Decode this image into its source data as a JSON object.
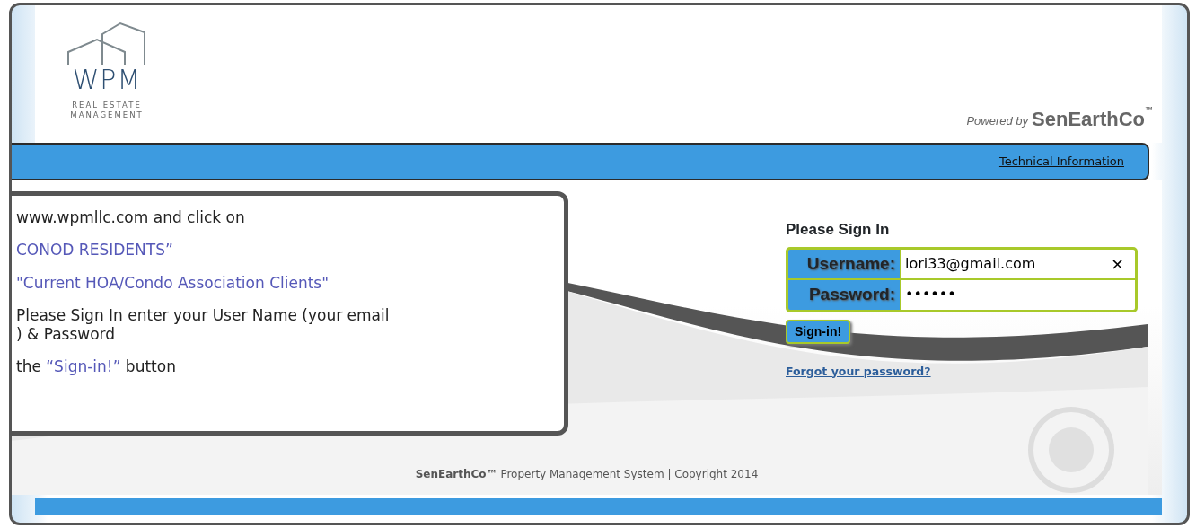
{
  "logo": {
    "wordmark": "WPM",
    "tagline_1": "REAL ESTATE",
    "tagline_2": "MANAGEMENT"
  },
  "powered_by": {
    "prefix": "Powered by",
    "brand": "SenEarthCo",
    "mark": "™"
  },
  "nav_bar": {
    "link": "Technical Information"
  },
  "callout": {
    "lines": [
      {
        "segments": [
          {
            "kind": "plain",
            "text": "www.wpmllc.com and click on"
          }
        ]
      },
      {
        "segments": [
          {
            "kind": "highlight",
            "text": "CONOD RESIDENTS”"
          }
        ]
      },
      {
        "segments": [
          {
            "kind": "highlight",
            "text": "\"Current HOA/Condo Association Clients\""
          }
        ]
      },
      {
        "rows": [
          "Please Sign In enter your User Name (your email",
          ") & Password"
        ]
      },
      {
        "segments": [
          {
            "kind": "plain",
            "text": "the"
          },
          {
            "kind": "highlight",
            "text": "“Sign-in!”"
          },
          {
            "kind": "plain",
            "text": "button"
          }
        ]
      }
    ]
  },
  "sign_in": {
    "title": "Please Sign In",
    "fields": [
      {
        "label": "Username:",
        "value": "lori33@gmail.com",
        "clear_button": "×"
      },
      {
        "label": "Password:",
        "value": "••••••"
      }
    ],
    "button": "Sign-in!",
    "forgot_link": "Forgot your password?"
  },
  "footer": "**SenEarthCo™** Property Management System | Copyright 2014"
}
